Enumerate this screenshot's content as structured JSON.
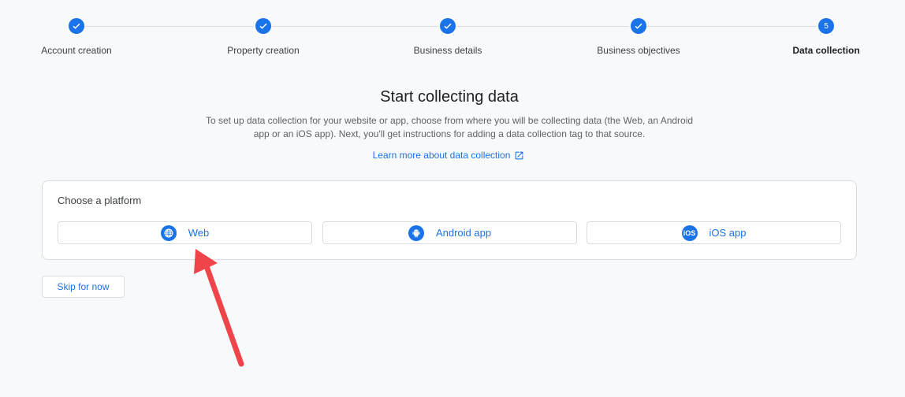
{
  "stepper": {
    "steps": [
      {
        "label": "Account creation",
        "state": "complete"
      },
      {
        "label": "Property creation",
        "state": "complete"
      },
      {
        "label": "Business details",
        "state": "complete"
      },
      {
        "label": "Business objectives",
        "state": "complete"
      },
      {
        "label": "Data collection",
        "number": "5",
        "state": "active"
      }
    ]
  },
  "main": {
    "title": "Start collecting data",
    "description": "To set up data collection for your website or app, choose from where you will be collecting data (the Web, an Android app or an iOS app). Next, you'll get instructions for adding a data collection tag to that source.",
    "learn_more": "Learn more about data collection"
  },
  "platform_card": {
    "title": "Choose a platform",
    "buttons": [
      {
        "label": "Web",
        "icon": "globe-icon"
      },
      {
        "label": "Android app",
        "icon": "android-icon"
      },
      {
        "label": "iOS app",
        "icon": "ios-icon",
        "icon_text": "iOS"
      }
    ]
  },
  "actions": {
    "skip_label": "Skip for now"
  },
  "colors": {
    "accent": "#1a73e8",
    "annotation_arrow": "#f0444b",
    "background": "#f8f9fa"
  }
}
